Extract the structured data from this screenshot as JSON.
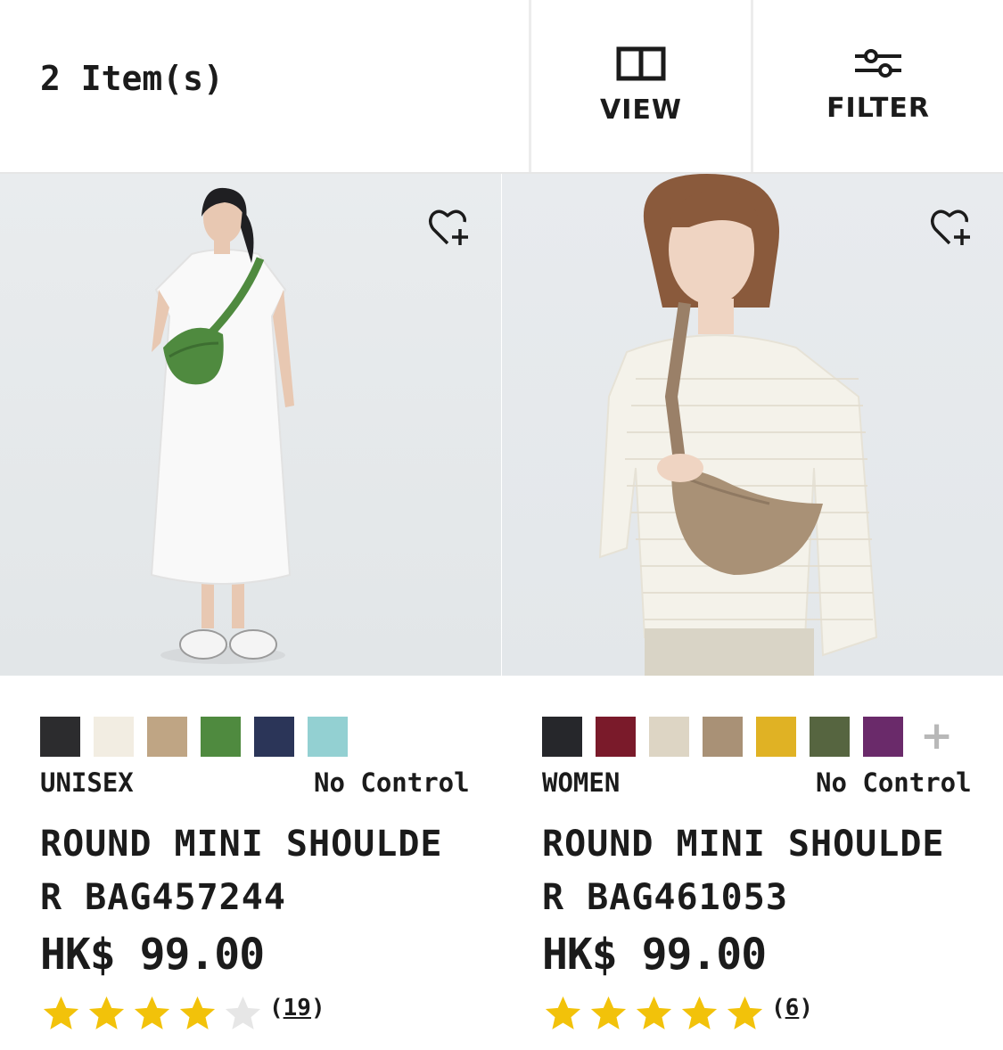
{
  "header": {
    "item_count": "2 Item(s)",
    "view_label": "VIEW",
    "filter_label": "FILTER"
  },
  "products": [
    {
      "gender": "UNISEX",
      "tag": "No Control",
      "name": "ROUND MINI SHOULDER BAG457244",
      "price": "HK$ 99.00",
      "rating": 4,
      "reviews_count": "19",
      "colors": [
        "#2c2c2e",
        "#f2ede2",
        "#bfa584",
        "#4f8a3f",
        "#2b3558",
        "#93d0d2"
      ]
    },
    {
      "gender": "WOMEN",
      "tag": "No Control",
      "name": "ROUND MINI SHOULDER BAG461053",
      "price": "HK$ 99.00",
      "rating": 5,
      "reviews_count": "6",
      "colors": [
        "#26272b",
        "#7a1a2a",
        "#ddd5c4",
        "#a99176",
        "#e0b224",
        "#566540",
        "#6a2a6a"
      ],
      "more_colors_icon": "plus-icon"
    }
  ],
  "colors": {
    "star_filled": "#f2c20a",
    "star_empty": "#e6e6e6"
  }
}
